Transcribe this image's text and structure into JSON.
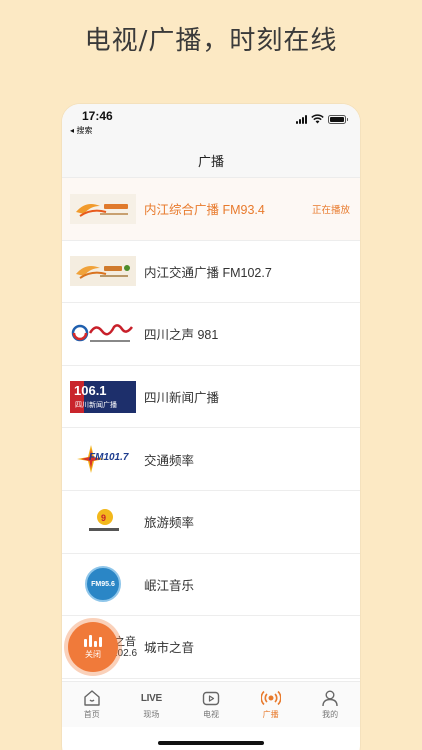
{
  "headline": "电视/广播，时刻在线",
  "statusbar": {
    "time": "17:46",
    "back_label": "◂ 搜索"
  },
  "navbar": {
    "title": "广播"
  },
  "stations": [
    {
      "name": "内江综合广播 FM93.4",
      "status": "正在播放",
      "active": true,
      "logo": "neijiang-radio-logo"
    },
    {
      "name": "内江交通广播 FM102.7",
      "status": "",
      "active": false,
      "logo": "neijiang-traffic-radio-logo"
    },
    {
      "name": "四川之声 981",
      "status": "",
      "active": false,
      "logo": "sichuan-voice-logo"
    },
    {
      "name": "四川新闻广播",
      "status": "",
      "active": false,
      "logo": "sichuan-news-106-logo"
    },
    {
      "name": "交通频率",
      "status": "",
      "active": false,
      "logo": "fm1017-traffic-logo"
    },
    {
      "name": "旅游频率",
      "status": "",
      "active": false,
      "logo": "tourism-radio-logo"
    },
    {
      "name": "岷江音乐",
      "status": "",
      "active": false,
      "logo": "minjiang-music-logo"
    },
    {
      "name": "城市之音",
      "status": "",
      "active": false,
      "logo": "city-voice-logo"
    }
  ],
  "logo_texts": {
    "fm106": "106.1",
    "fm106_sub": "四川新闻广播",
    "fm1017": "FM101.7",
    "minjiang": "FM95.6",
    "city_partial": "之音",
    "city_freq": "102.6"
  },
  "float_button": {
    "label": "关闭"
  },
  "tabs": [
    {
      "label": "首页",
      "icon": "home-icon",
      "active": false
    },
    {
      "label": "现场",
      "icon": "live-icon",
      "icon_text": "LIVE",
      "active": false
    },
    {
      "label": "电视",
      "icon": "tv-icon",
      "active": false
    },
    {
      "label": "广播",
      "icon": "broadcast-icon",
      "active": true
    },
    {
      "label": "我的",
      "icon": "user-icon",
      "active": false
    }
  ],
  "colors": {
    "accent": "#e87a2c",
    "background": "#fce9c4"
  }
}
